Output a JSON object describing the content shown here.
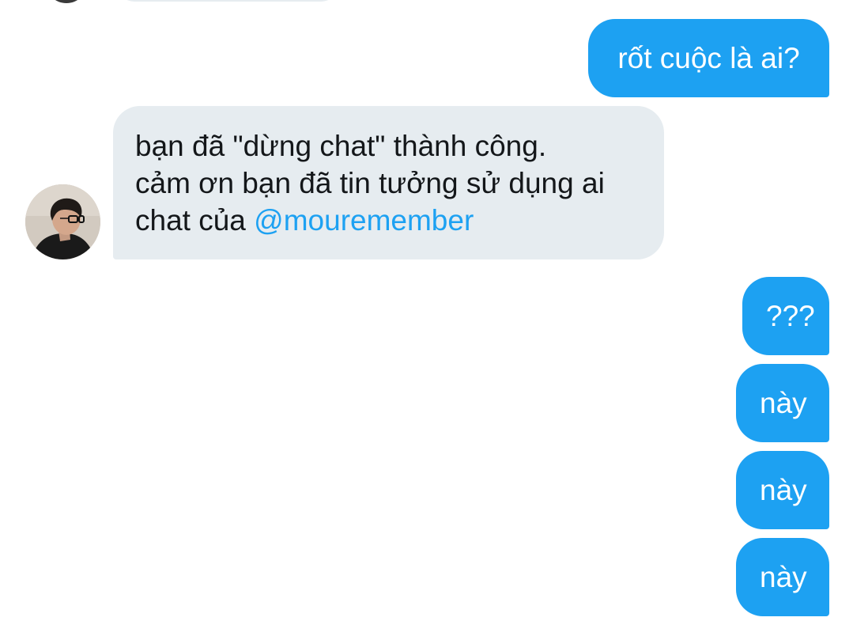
{
  "colors": {
    "outgoing_bubble": "#1da1f2",
    "incoming_bubble": "#e6ecf0",
    "mention": "#1da1f2",
    "incoming_text": "#14171a",
    "outgoing_text": "#ffffff"
  },
  "contact": {
    "avatar_icon": "profile-photo-person-with-glasses"
  },
  "messages": [
    {
      "direction": "outgoing",
      "text": "rốt cuộc là ai?"
    },
    {
      "direction": "incoming",
      "line1": "bạn đã \"dừng chat\" thành công.",
      "line2": "cảm ơn bạn đã tin tưởng sử dụng ai",
      "line3_prefix": "chat của ",
      "mention": "@mouremember"
    },
    {
      "direction": "outgoing",
      "text": "???"
    },
    {
      "direction": "outgoing",
      "text": "này"
    },
    {
      "direction": "outgoing",
      "text": "này"
    },
    {
      "direction": "outgoing",
      "text": "này"
    }
  ]
}
